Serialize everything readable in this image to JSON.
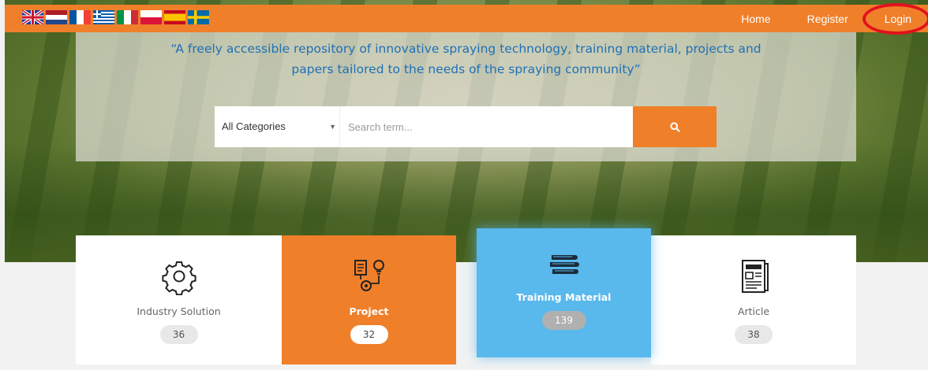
{
  "header": {
    "flags": [
      "uk-flag-icon",
      "netherlands-flag-icon",
      "france-flag-icon",
      "greece-flag-icon",
      "italy-flag-icon",
      "poland-flag-icon",
      "spain-flag-icon",
      "sweden-flag-icon"
    ],
    "nav": {
      "home": "Home",
      "register": "Register",
      "login": "Login"
    }
  },
  "banner": {
    "tagline_line1": "“A freely accessible repository of innovative spraying technology, training material, projects and",
    "tagline_line2": "papers tailored to the needs of the spraying community”"
  },
  "search": {
    "category": "All Categories",
    "placeholder": "Search term...",
    "button_icon": "search-icon"
  },
  "categories": [
    {
      "label": "Industry Solution",
      "count": "36",
      "icon": "gear-icon"
    },
    {
      "label": "Project",
      "count": "32",
      "icon": "project-icon"
    },
    {
      "label": "Training Material",
      "count": "139",
      "icon": "books-icon"
    },
    {
      "label": "Article",
      "count": "38",
      "icon": "newspaper-icon"
    }
  ],
  "colors": {
    "accent": "#f07f2a",
    "link": "#1e70b6",
    "highlight": "#59b8ec",
    "annotation": "#e1121d"
  }
}
